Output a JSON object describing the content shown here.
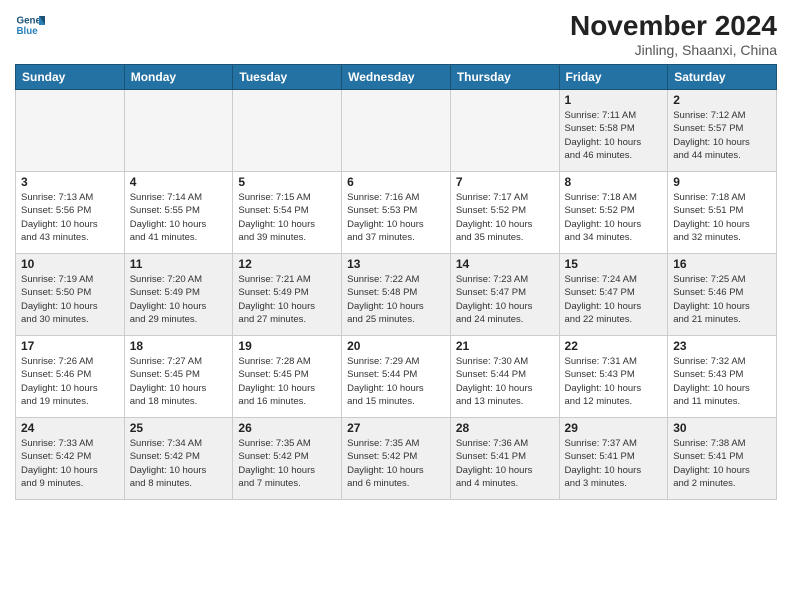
{
  "header": {
    "logo_general": "General",
    "logo_blue": "Blue",
    "title": "November 2024",
    "location": "Jinling, Shaanxi, China"
  },
  "weekdays": [
    "Sunday",
    "Monday",
    "Tuesday",
    "Wednesday",
    "Thursday",
    "Friday",
    "Saturday"
  ],
  "weeks": [
    [
      {
        "day": "",
        "info": "",
        "empty": true
      },
      {
        "day": "",
        "info": "",
        "empty": true
      },
      {
        "day": "",
        "info": "",
        "empty": true
      },
      {
        "day": "",
        "info": "",
        "empty": true
      },
      {
        "day": "",
        "info": "",
        "empty": true
      },
      {
        "day": "1",
        "info": "Sunrise: 7:11 AM\nSunset: 5:58 PM\nDaylight: 10 hours\nand 46 minutes."
      },
      {
        "day": "2",
        "info": "Sunrise: 7:12 AM\nSunset: 5:57 PM\nDaylight: 10 hours\nand 44 minutes."
      }
    ],
    [
      {
        "day": "3",
        "info": "Sunrise: 7:13 AM\nSunset: 5:56 PM\nDaylight: 10 hours\nand 43 minutes."
      },
      {
        "day": "4",
        "info": "Sunrise: 7:14 AM\nSunset: 5:55 PM\nDaylight: 10 hours\nand 41 minutes."
      },
      {
        "day": "5",
        "info": "Sunrise: 7:15 AM\nSunset: 5:54 PM\nDaylight: 10 hours\nand 39 minutes."
      },
      {
        "day": "6",
        "info": "Sunrise: 7:16 AM\nSunset: 5:53 PM\nDaylight: 10 hours\nand 37 minutes."
      },
      {
        "day": "7",
        "info": "Sunrise: 7:17 AM\nSunset: 5:52 PM\nDaylight: 10 hours\nand 35 minutes."
      },
      {
        "day": "8",
        "info": "Sunrise: 7:18 AM\nSunset: 5:52 PM\nDaylight: 10 hours\nand 34 minutes."
      },
      {
        "day": "9",
        "info": "Sunrise: 7:18 AM\nSunset: 5:51 PM\nDaylight: 10 hours\nand 32 minutes."
      }
    ],
    [
      {
        "day": "10",
        "info": "Sunrise: 7:19 AM\nSunset: 5:50 PM\nDaylight: 10 hours\nand 30 minutes."
      },
      {
        "day": "11",
        "info": "Sunrise: 7:20 AM\nSunset: 5:49 PM\nDaylight: 10 hours\nand 29 minutes."
      },
      {
        "day": "12",
        "info": "Sunrise: 7:21 AM\nSunset: 5:49 PM\nDaylight: 10 hours\nand 27 minutes."
      },
      {
        "day": "13",
        "info": "Sunrise: 7:22 AM\nSunset: 5:48 PM\nDaylight: 10 hours\nand 25 minutes."
      },
      {
        "day": "14",
        "info": "Sunrise: 7:23 AM\nSunset: 5:47 PM\nDaylight: 10 hours\nand 24 minutes."
      },
      {
        "day": "15",
        "info": "Sunrise: 7:24 AM\nSunset: 5:47 PM\nDaylight: 10 hours\nand 22 minutes."
      },
      {
        "day": "16",
        "info": "Sunrise: 7:25 AM\nSunset: 5:46 PM\nDaylight: 10 hours\nand 21 minutes."
      }
    ],
    [
      {
        "day": "17",
        "info": "Sunrise: 7:26 AM\nSunset: 5:46 PM\nDaylight: 10 hours\nand 19 minutes."
      },
      {
        "day": "18",
        "info": "Sunrise: 7:27 AM\nSunset: 5:45 PM\nDaylight: 10 hours\nand 18 minutes."
      },
      {
        "day": "19",
        "info": "Sunrise: 7:28 AM\nSunset: 5:45 PM\nDaylight: 10 hours\nand 16 minutes."
      },
      {
        "day": "20",
        "info": "Sunrise: 7:29 AM\nSunset: 5:44 PM\nDaylight: 10 hours\nand 15 minutes."
      },
      {
        "day": "21",
        "info": "Sunrise: 7:30 AM\nSunset: 5:44 PM\nDaylight: 10 hours\nand 13 minutes."
      },
      {
        "day": "22",
        "info": "Sunrise: 7:31 AM\nSunset: 5:43 PM\nDaylight: 10 hours\nand 12 minutes."
      },
      {
        "day": "23",
        "info": "Sunrise: 7:32 AM\nSunset: 5:43 PM\nDaylight: 10 hours\nand 11 minutes."
      }
    ],
    [
      {
        "day": "24",
        "info": "Sunrise: 7:33 AM\nSunset: 5:42 PM\nDaylight: 10 hours\nand 9 minutes."
      },
      {
        "day": "25",
        "info": "Sunrise: 7:34 AM\nSunset: 5:42 PM\nDaylight: 10 hours\nand 8 minutes."
      },
      {
        "day": "26",
        "info": "Sunrise: 7:35 AM\nSunset: 5:42 PM\nDaylight: 10 hours\nand 7 minutes."
      },
      {
        "day": "27",
        "info": "Sunrise: 7:35 AM\nSunset: 5:42 PM\nDaylight: 10 hours\nand 6 minutes."
      },
      {
        "day": "28",
        "info": "Sunrise: 7:36 AM\nSunset: 5:41 PM\nDaylight: 10 hours\nand 4 minutes."
      },
      {
        "day": "29",
        "info": "Sunrise: 7:37 AM\nSunset: 5:41 PM\nDaylight: 10 hours\nand 3 minutes."
      },
      {
        "day": "30",
        "info": "Sunrise: 7:38 AM\nSunset: 5:41 PM\nDaylight: 10 hours\nand 2 minutes."
      }
    ]
  ]
}
